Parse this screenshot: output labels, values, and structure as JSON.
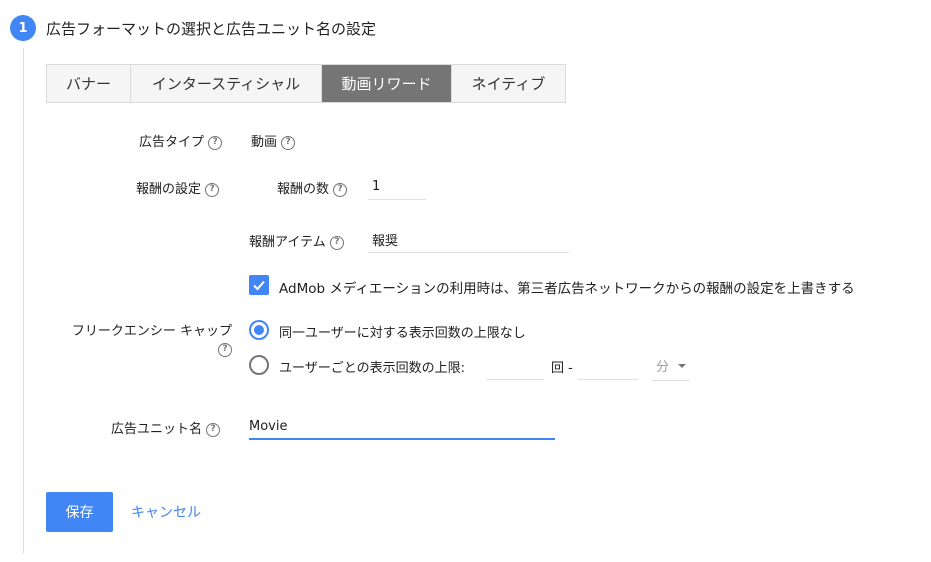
{
  "step": {
    "number": "1",
    "title": "広告フォーマットの選択と広告ユニット名の設定"
  },
  "tabs": [
    {
      "label": "バナー",
      "active": false
    },
    {
      "label": "インタースティシャル",
      "active": false
    },
    {
      "label": "動画リワード",
      "active": true
    },
    {
      "label": "ネイティブ",
      "active": false
    }
  ],
  "ad_type": {
    "label": "広告タイプ",
    "value": "動画"
  },
  "reward": {
    "label": "報酬の設定",
    "amount_label": "報酬の数",
    "amount_value": "1",
    "item_label": "報酬アイテム",
    "item_value": "報奨",
    "override_label": "AdMob メディエーションの利用時は、第三者広告ネットワークからの報酬の設定を上書きする",
    "override_checked": true
  },
  "frequency_cap": {
    "label": "フリークエンシー キャップ",
    "option_none": "同一ユーザーに対する表示回数の上限なし",
    "option_limit": "ユーザーごとの表示回数の上限:",
    "times_suffix": "回 -",
    "unit_value": "分",
    "selected": "none"
  },
  "ad_unit_name": {
    "label": "広告ユニット名",
    "value": "Movie"
  },
  "actions": {
    "save": "保存",
    "cancel": "キャンセル"
  },
  "colors": {
    "accent": "#4285f4",
    "active_tab": "#757575"
  },
  "icons": {
    "help": "?",
    "check": "check-icon"
  }
}
